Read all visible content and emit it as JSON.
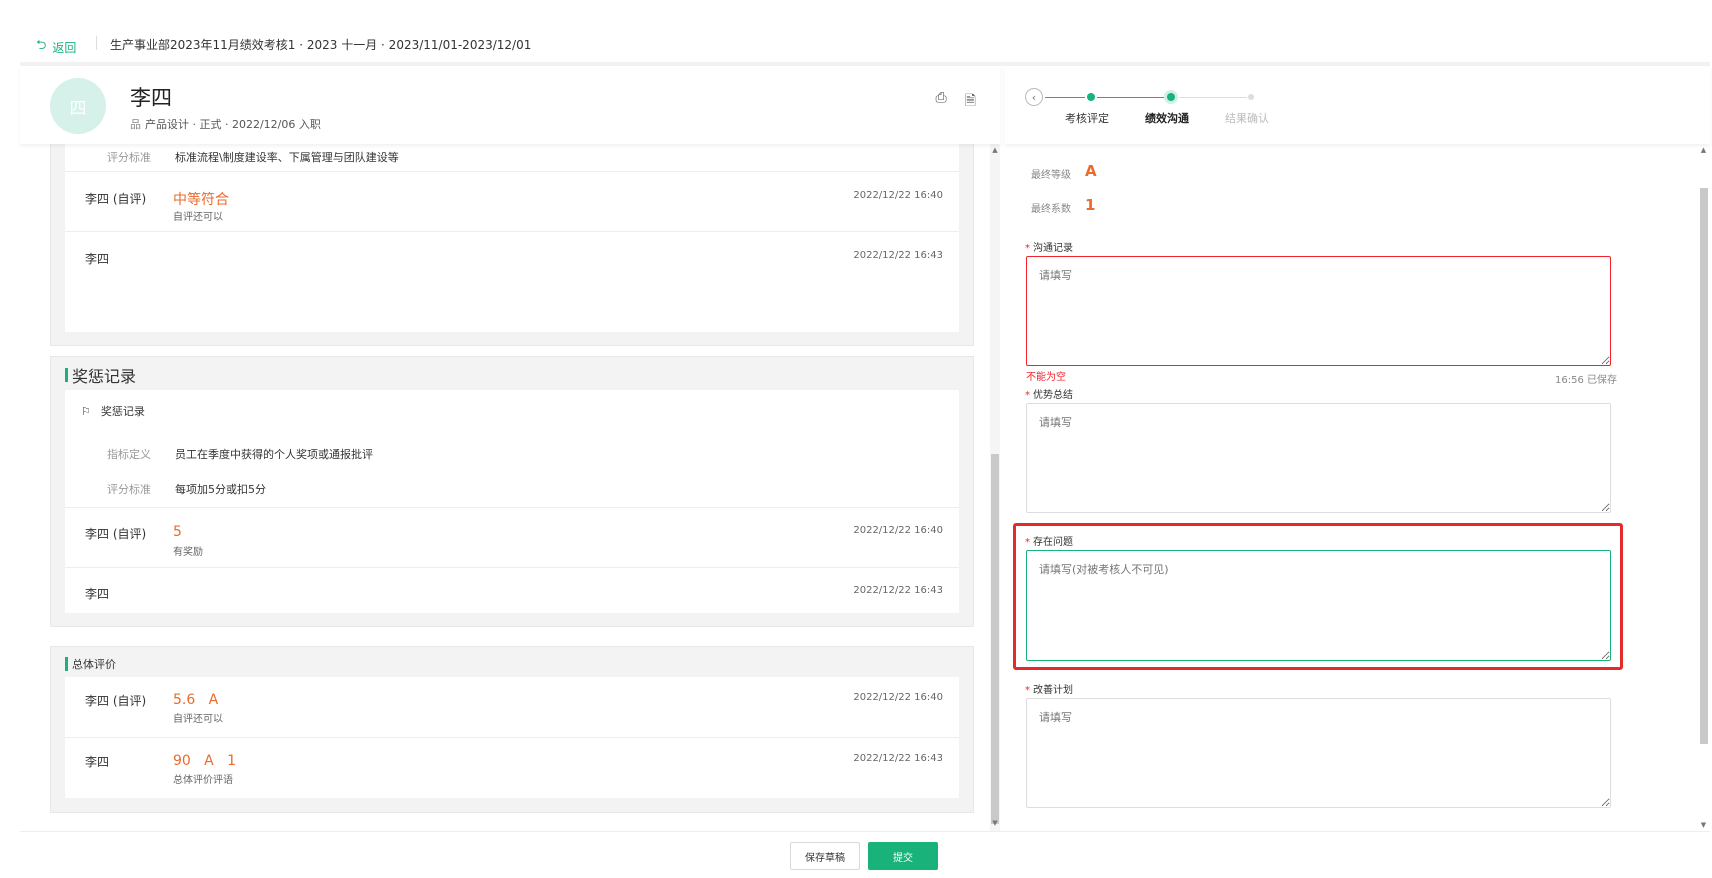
{
  "topbar": {
    "back_label": "返回",
    "breadcrumb": "生产事业部2023年11月绩效考核1 · 2023 十一月 · 2023/11/01-2023/12/01"
  },
  "employee": {
    "avatar_char": "四",
    "name": "李四",
    "meta": "产品设计 · 正式 · 2022/12/06 入职"
  },
  "section1": {
    "criteria_label": "评分标准",
    "criteria_value": "标准流程\\制度建设率、下属管理与团队建设等",
    "reviews": [
      {
        "who": "李四 (自评)",
        "value": "中等符合",
        "note": "自评还可以",
        "time": "2022/12/22 16:40"
      },
      {
        "who": "李四",
        "value": "",
        "note": "",
        "time": "2022/12/22 16:43"
      }
    ]
  },
  "rewards": {
    "title": "奖惩记录",
    "subtitle": "奖惩记录",
    "def_label": "指标定义",
    "def_value": "员工在季度中获得的个人奖项或通报批评",
    "criteria_label": "评分标准",
    "criteria_value": "每项加5分或扣5分",
    "reviews": [
      {
        "who": "李四 (自评)",
        "value": "5",
        "note": "有奖励",
        "time": "2022/12/22 16:40"
      },
      {
        "who": "李四",
        "value": "",
        "note": "",
        "time": "2022/12/22 16:43"
      }
    ]
  },
  "overall": {
    "title": "总体评价",
    "reviews": [
      {
        "who": "李四 (自评)",
        "value": "5.6   A",
        "note": "自评还可以",
        "time": "2022/12/22 16:40"
      },
      {
        "who": "李四",
        "value": "90   A   1",
        "note": "总体评价评语",
        "time": "2022/12/22 16:43"
      }
    ]
  },
  "steps": {
    "items": [
      "考核评定",
      "绩效沟通",
      "结果确认"
    ],
    "active_index": 1
  },
  "result": {
    "grade_label": "最终等级",
    "grade_value": "A",
    "coef_label": "最终系数",
    "coef_value": "1"
  },
  "form": {
    "comm_label": "沟通记录",
    "comm_placeholder": "请填写",
    "comm_error": "不能为空",
    "saved_text": "16:56 已保存",
    "strength_label": "优势总结",
    "strength_placeholder": "请填写",
    "problem_label": "存在问题",
    "problem_placeholder": "请填写(对被考核人不可见)",
    "plan_label": "改善计划",
    "plan_placeholder": "请填写"
  },
  "footer": {
    "draft_label": "保存草稿",
    "submit_label": "提交"
  },
  "colors": {
    "accent": "#19b27b",
    "value_orange": "#e96b2d",
    "error_red": "#f5222d",
    "highlight_red": "#e32b2b"
  }
}
